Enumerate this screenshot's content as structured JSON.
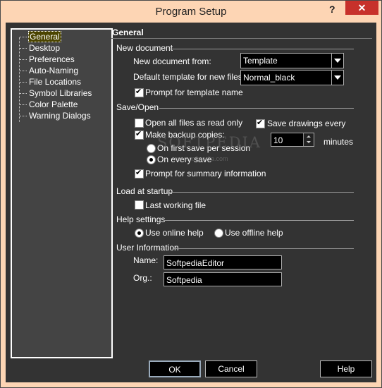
{
  "window": {
    "title": "Program Setup",
    "help_glyph": "?",
    "close_glyph": "✕"
  },
  "tree": {
    "items": [
      {
        "label": "General",
        "selected": true
      },
      {
        "label": "Desktop"
      },
      {
        "label": "Preferences"
      },
      {
        "label": "Auto-Naming"
      },
      {
        "label": "File Locations"
      },
      {
        "label": "Symbol Libraries"
      },
      {
        "label": "Color Palette"
      },
      {
        "label": "Warning Dialogs"
      }
    ]
  },
  "panel": {
    "title": "General",
    "new_document": {
      "section": "New document",
      "from_label": "New document from:",
      "from_value": "Template",
      "template_label": "Default template for new files:",
      "template_value": "Normal_black",
      "prompt_label": "Prompt for template name",
      "prompt_checked": true
    },
    "save_open": {
      "section": "Save/Open",
      "read_only_label": "Open all files as read only",
      "read_only_checked": false,
      "backup_label": "Make backup copies:",
      "backup_checked": true,
      "first_save_label": "On first save per session",
      "every_save_label": "On every save",
      "save_drawings_label": "Save drawings every",
      "save_drawings_checked": true,
      "minutes_value": "10",
      "minutes_label": "minutes",
      "summary_label": "Prompt for summary information",
      "summary_checked": true
    },
    "startup": {
      "section": "Load at startup",
      "last_file_label": "Last working file",
      "last_file_checked": false
    },
    "help_settings": {
      "section": "Help settings",
      "online_label": "Use online help",
      "offline_label": "Use offline help"
    },
    "user_info": {
      "section": "User Information",
      "name_label": "Name:",
      "name_value": "SoftpediaEditor",
      "org_label": "Org.:",
      "org_value": "Softpedia"
    }
  },
  "buttons": {
    "ok": "OK",
    "cancel": "Cancel",
    "help": "Help"
  },
  "watermark": {
    "main": "SOFTPEDIA",
    "sub": "www.softpedia.com"
  }
}
